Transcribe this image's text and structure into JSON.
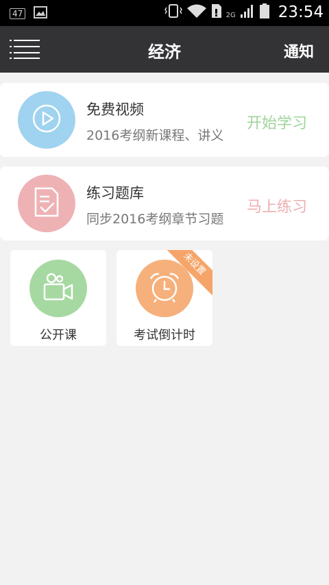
{
  "status_bar": {
    "notification_count": "47",
    "network": "2G",
    "time": "23:54"
  },
  "header": {
    "title": "经济",
    "notify_label": "通知",
    "menu_icon": "menu-icon"
  },
  "cards": [
    {
      "title": "免费视频",
      "subtitle": "2016考纲新课程、讲义",
      "action": "开始学习",
      "icon": "play-icon",
      "circle_color": "#9fd3ef",
      "action_color": "#9ed59a"
    },
    {
      "title": "练习题库",
      "subtitle": "同步2016考纲章节习题",
      "action": "马上练习",
      "icon": "document-check-icon",
      "circle_color": "#eeb2b5",
      "action_color": "#efadb0"
    }
  ],
  "tiles": [
    {
      "label": "公开课",
      "icon": "video-camera-icon",
      "circle_color": "#a6d9a1"
    },
    {
      "label": "考试倒计时",
      "icon": "alarm-clock-icon",
      "circle_color": "#f6b07c",
      "ribbon": "未设置"
    }
  ]
}
